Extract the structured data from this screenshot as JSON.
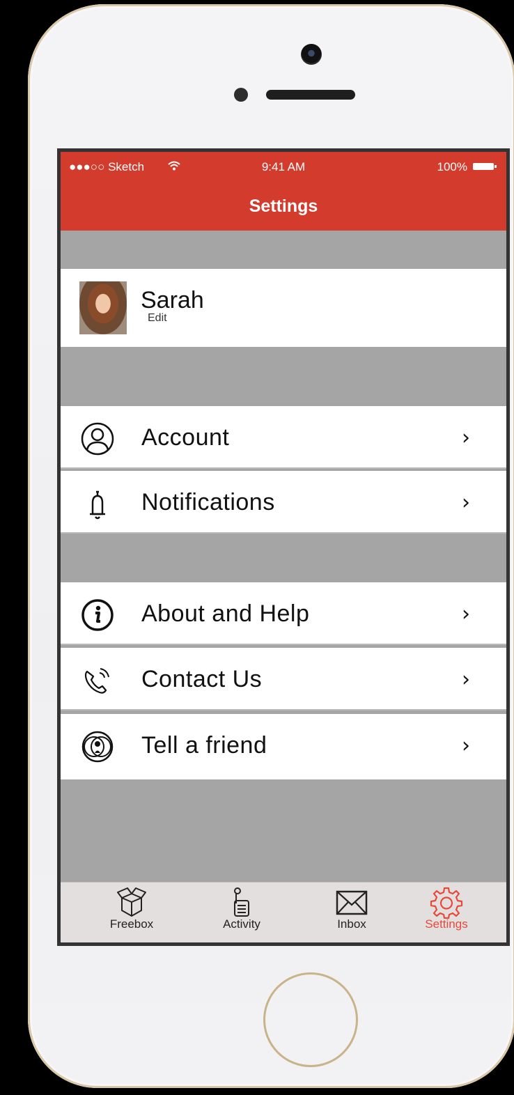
{
  "status_bar": {
    "carrier": "●●●○○ Sketch",
    "time": "9:41 AM",
    "battery": "100%"
  },
  "nav": {
    "title": "Settings"
  },
  "profile": {
    "name": "Sarah",
    "edit_label": "Edit"
  },
  "menu": {
    "account": {
      "label": "Account",
      "icon": "user-circle-icon"
    },
    "notifications": {
      "label": "Notifications",
      "icon": "bell-icon"
    },
    "about": {
      "label": "About and Help",
      "icon": "info-icon"
    },
    "contact": {
      "label": "Contact Us",
      "icon": "phone-icon"
    },
    "tell": {
      "label": "Tell a friend",
      "icon": "share-icon"
    }
  },
  "tabs": {
    "freebox": {
      "label": "Freebox",
      "icon": "box-icon"
    },
    "activity": {
      "label": "Activity",
      "icon": "activity-icon"
    },
    "inbox": {
      "label": "Inbox",
      "icon": "envelope-icon"
    },
    "settings": {
      "label": "Settings",
      "icon": "gear-icon"
    }
  },
  "colors": {
    "accent": "#d33b2c",
    "active_tab": "#e8483a",
    "section_gap": "#a5a5a5"
  }
}
